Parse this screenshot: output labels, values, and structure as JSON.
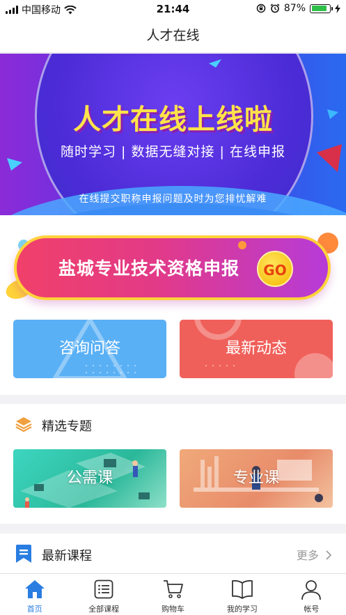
{
  "status_bar": {
    "carrier": "中国移动",
    "time": "21:44",
    "battery": "87%",
    "battery_level": 0.87
  },
  "nav": {
    "title": "人才在线"
  },
  "hero": {
    "title": "人才在线上线啦",
    "subtitle": "随时学习 | 数据无缝对接 | 在线申报",
    "footer": "在线提交职称申报问题及时为您排忧解难"
  },
  "apply_banner": {
    "label": "盐城专业技术资格申报",
    "go": "GO"
  },
  "quick_cards": [
    {
      "label": "咨询问答",
      "color": "#5ab0f5"
    },
    {
      "label": "最新动态",
      "color": "#f0605a"
    }
  ],
  "topics": {
    "title": "精选专题",
    "items": [
      {
        "label": "公需课"
      },
      {
        "label": "专业课"
      }
    ]
  },
  "courses": {
    "title": "最新课程",
    "more": "更多"
  },
  "tab_bar": {
    "items": [
      {
        "label": "首页",
        "icon": "home-icon",
        "active": true
      },
      {
        "label": "全部课程",
        "icon": "list-icon",
        "active": false
      },
      {
        "label": "购物车",
        "icon": "cart-icon",
        "active": false
      },
      {
        "label": "我的学习",
        "icon": "book-icon",
        "active": false
      },
      {
        "label": "帐号",
        "icon": "user-icon",
        "active": false
      }
    ]
  },
  "colors": {
    "accent": "#2a7de1",
    "hero_title": "#ffe34a"
  }
}
